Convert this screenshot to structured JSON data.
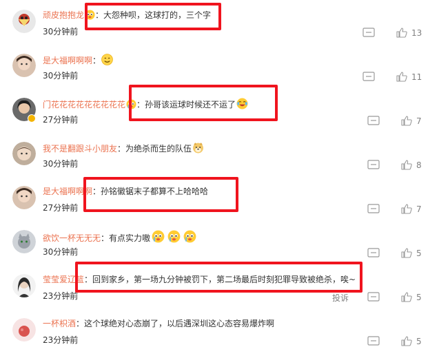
{
  "comments": [
    {
      "user": "顽皮抱抱龙",
      "sep": "：",
      "text": "大怨种呗，这球打的，三个字",
      "time": "30分钟前",
      "likes": "13",
      "emoji_inline": [
        "crying-face"
      ],
      "emoji_after": []
    },
    {
      "user": "是大福啊啊啊",
      "sep": "：",
      "text": "",
      "time": "30分钟前",
      "likes": "11",
      "emoji_inline": [],
      "emoji_after": [
        "smile-face"
      ]
    },
    {
      "user": "门花花花花花花花花花",
      "sep": "：",
      "text": "孙哥该运球时候还不运了",
      "time": "27分钟前",
      "likes": "7",
      "emoji_inline": [
        "crying-face"
      ],
      "emoji_after": [
        "laugh-cry-face"
      ]
    },
    {
      "user": "我不是翻跟斗小朋友",
      "sep": "：",
      "text": "为绝杀而生的队伍",
      "time": "30分钟前",
      "likes": "8",
      "emoji_inline": [],
      "emoji_after": [
        "doge-face"
      ]
    },
    {
      "user": "是大福啊啊啊",
      "sep": "：",
      "text": "孙铭徽锯末子都算不上哈哈哈",
      "time": "27分钟前",
      "likes": "7",
      "emoji_inline": [],
      "emoji_after": []
    },
    {
      "user": "欲饮一杯无无无",
      "sep": "：",
      "text": "有点实力嗷",
      "time": "30分钟前",
      "likes": "5",
      "emoji_inline": [],
      "emoji_after": [
        "crying-face",
        "crying-face",
        "crying-face"
      ]
    },
    {
      "user": "莹莹爱辽篮",
      "sep": "：",
      "text": "回到家乡，第一场九分钟被罚下，第二场最后时刻犯罪导致被绝杀，唉~",
      "time": "23分钟前",
      "likes": "5",
      "emoji_inline": [],
      "emoji_after": []
    },
    {
      "user": "一杯枳酒",
      "sep": "：",
      "text": "这个球绝对心态崩了，以后遇深圳这心态容易爆炸啊",
      "time": "23分钟前",
      "likes": "5",
      "emoji_inline": [],
      "emoji_after": []
    }
  ],
  "report_label": "投诉",
  "colors": {
    "username": "#eb7350",
    "highlight": "#f0141e",
    "meta": "#808080"
  }
}
